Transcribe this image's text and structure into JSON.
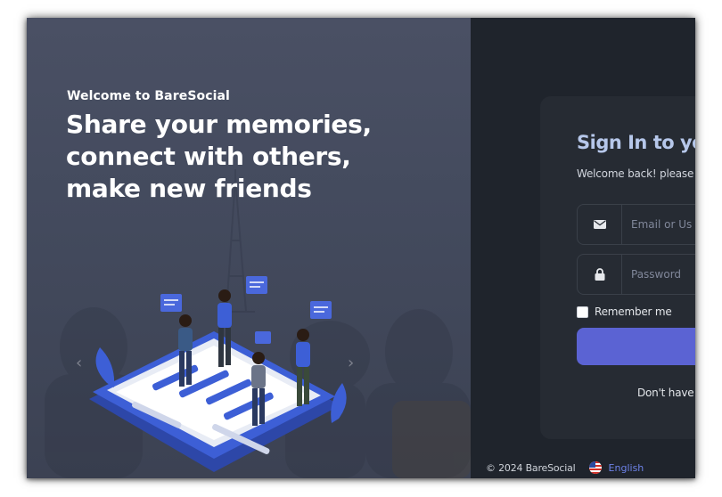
{
  "hero": {
    "welcome": "Welcome to BareSocial",
    "tagline": [
      "Share your memories,",
      "connect with others,",
      "make new friends"
    ],
    "prev_icon": "chevron-left-icon",
    "next_icon": "chevron-right-icon"
  },
  "signin": {
    "title": "Sign In to yo",
    "subtitle": "Welcome back! please",
    "email_placeholder": "Email or Us",
    "email_icon": "envelope-icon",
    "password_placeholder": "Password",
    "password_icon": "lock-icon",
    "remember_label": "Remember me",
    "signup_text": "Don't have"
  },
  "footer": {
    "copyright": "© 2024 BareSocial",
    "language": "English",
    "flag_icon": "us-flag-icon"
  },
  "colors": {
    "accent": "#5b63d3",
    "title": "#b6c7ea",
    "panel_bg": "#1f242c",
    "card_bg": "#262b33",
    "link": "#6d82e8"
  }
}
